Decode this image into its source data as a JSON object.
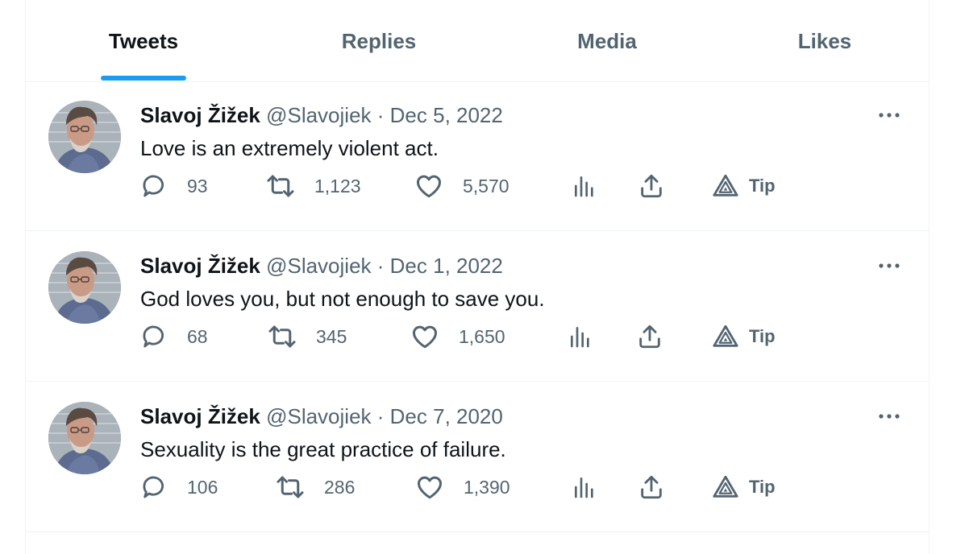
{
  "tabs": [
    {
      "label": "Tweets",
      "active": true
    },
    {
      "label": "Replies",
      "active": false
    },
    {
      "label": "Media",
      "active": false
    },
    {
      "label": "Likes",
      "active": false
    }
  ],
  "tweets": [
    {
      "name": "Slavoj Žižek",
      "handle": "@Slavojiek",
      "date": "· Dec 5, 2022",
      "text": "Love is an extremely violent act.",
      "replies": "93",
      "retweets": "1,123",
      "likes": "5,570",
      "tip_label": "Tip"
    },
    {
      "name": "Slavoj Žižek",
      "handle": "@Slavojiek",
      "date": "· Dec 1, 2022",
      "text": "God loves you, but not enough to save you.",
      "replies": "68",
      "retweets": "345",
      "likes": "1,650",
      "tip_label": "Tip"
    },
    {
      "name": "Slavoj Žižek",
      "handle": "@Slavojiek",
      "date": "· Dec 7, 2020",
      "text": "Sexuality is the great practice of failure.",
      "replies": "106",
      "retweets": "286",
      "likes": "1,390",
      "tip_label": "Tip"
    }
  ],
  "colors": {
    "accent": "#1d9bf0",
    "text_primary": "#0f1419",
    "text_secondary": "#536471",
    "border": "#eff3f4"
  },
  "icons": [
    "reply-icon",
    "retweet-icon",
    "like-icon",
    "views-icon",
    "share-icon",
    "tip-icon",
    "more-icon"
  ]
}
